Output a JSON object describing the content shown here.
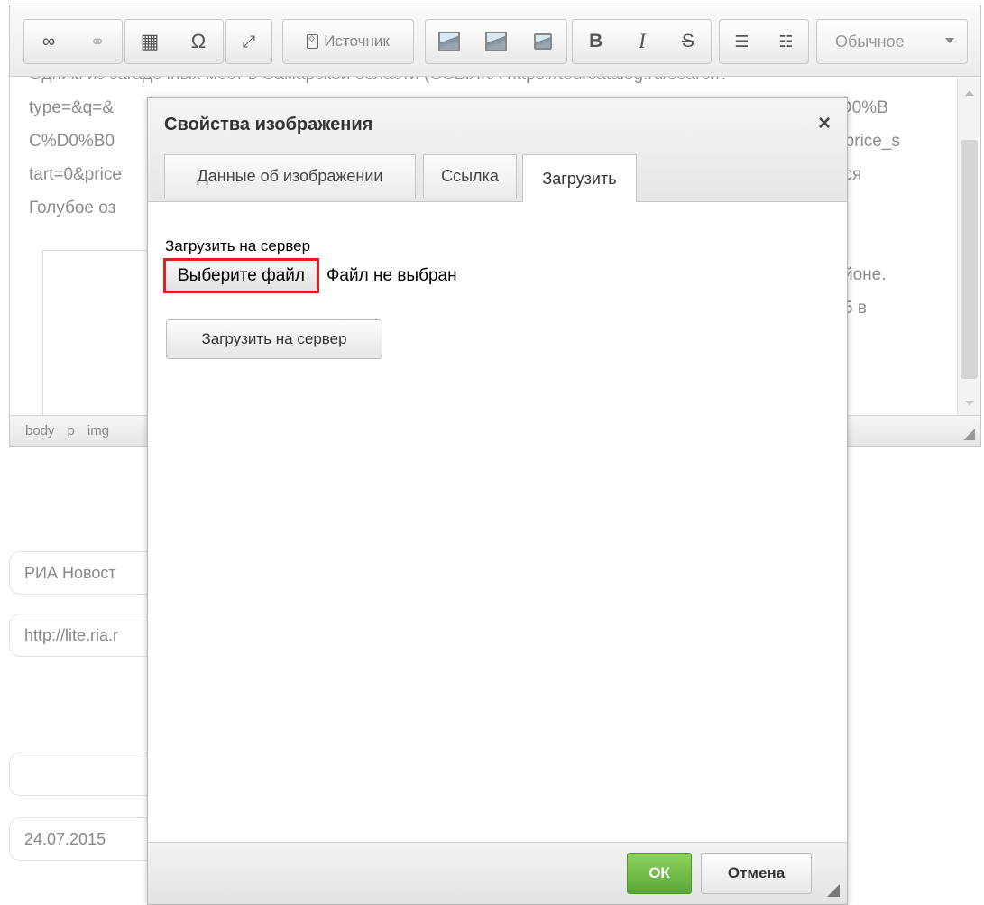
{
  "editor": {
    "toolbar": {
      "source_label": "Источник",
      "bold": "B",
      "italic": "I",
      "strike": "S",
      "omega": "Ω",
      "style_value": "Обычное",
      "icons": [
        "link-icon",
        "unlink-icon",
        "table-icon",
        "special-char-icon",
        "maximize-icon",
        "source-icon",
        "image-icon",
        "image-alt-icon",
        "image-small-icon",
        "bold-icon",
        "italic-icon",
        "strike-icon",
        "numbered-list-icon",
        "bullet-list-icon"
      ]
    },
    "content": {
      "line0": "Одним из загадочных мест в Самарской области (ССЫЛКА https://tourcatalog.ru/search?",
      "line1": "type=&q=&",
      "line1_right": "%D0%B",
      "line2": "C%D0%B0",
      "line2_right": "&price_s",
      "line3": "tart=0&price",
      "line3_right": "тся",
      "line4": "Голубое оз",
      "line5_right": "йоне.",
      "line6_right": "5 в"
    },
    "status_path": [
      "body",
      "p",
      "img"
    ]
  },
  "form": {
    "source_name": "РИА Новост",
    "source_url": "http://lite.ria.r",
    "empty_field": "",
    "date": "24.07.2015"
  },
  "dialog": {
    "title": "Свойства изображения",
    "close": "×",
    "tabs": [
      "Данные об изображении",
      "Ссылка",
      "Загрузить"
    ],
    "active_tab": "Загрузить",
    "upload_label": "Загрузить на сервер",
    "choose_file": "Выберите файл",
    "file_status": "Файл не выбран",
    "upload_button": "Загрузить на сервер",
    "ok": "ОК",
    "cancel": "Отмена"
  },
  "colors": {
    "ok_green": "#6cbb47",
    "highlight_red": "#e02020"
  }
}
